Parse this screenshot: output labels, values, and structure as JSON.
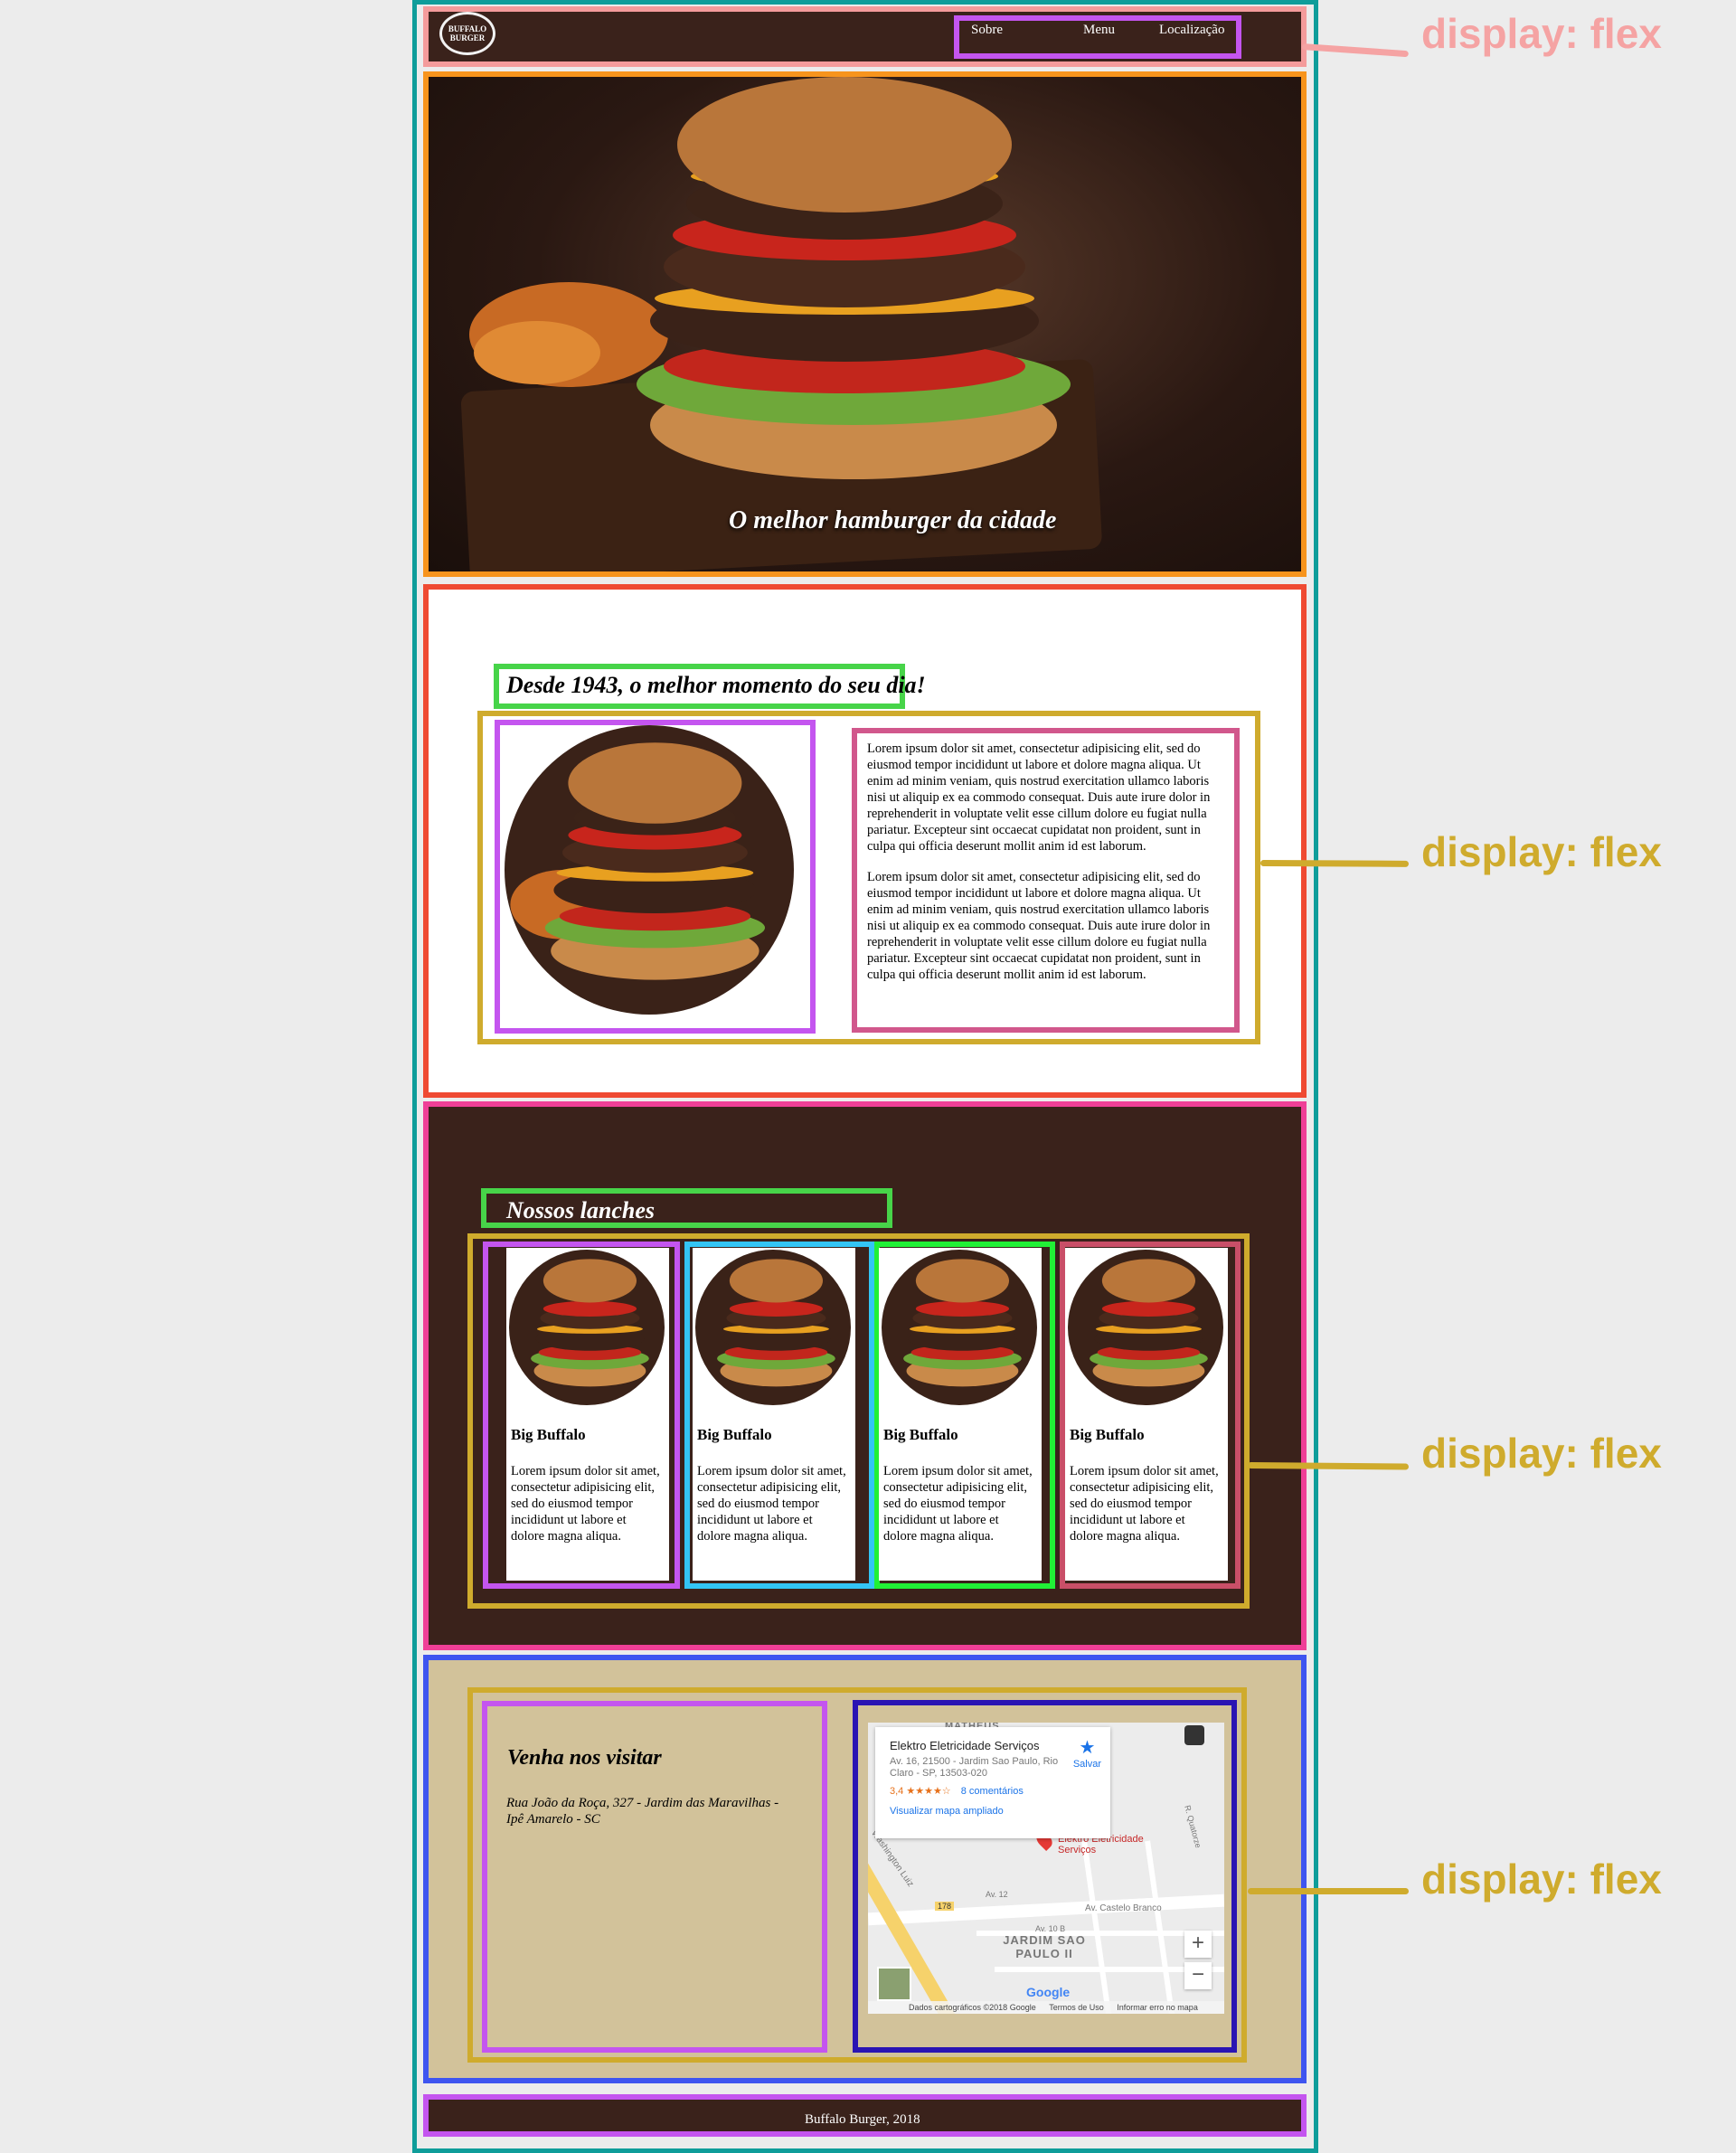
{
  "header": {
    "logo_line1": "BUFFALO",
    "logo_line2": "BURGER",
    "nav": [
      "Sobre",
      "Menu",
      "Localização"
    ]
  },
  "hero": {
    "title": "O melhor hamburger da cidade"
  },
  "about": {
    "heading": "Desde 1943, o melhor momento do seu dia!",
    "paragraphs": [
      "Lorem ipsum dolor sit amet, consectetur adipisicing elit, sed do eiusmod tempor incididunt ut labore et dolore magna aliqua. Ut enim ad minim veniam, quis nostrud exercitation ullamco laboris nisi ut aliquip ex ea commodo consequat. Duis aute irure dolor in reprehenderit in voluptate velit esse cillum dolore eu fugiat nulla pariatur. Excepteur sint occaecat cupidatat non proident, sunt in culpa qui officia deserunt mollit anim id est laborum.",
      "Lorem ipsum dolor sit amet, consectetur adipisicing elit, sed do eiusmod tempor incididunt ut labore et dolore magna aliqua. Ut enim ad minim veniam, quis nostrud exercitation ullamco laboris nisi ut aliquip ex ea commodo consequat. Duis aute irure dolor in reprehenderit in voluptate velit esse cillum dolore eu fugiat nulla pariatur. Excepteur sint occaecat cupidatat non proident, sunt in culpa qui officia deserunt mollit anim id est laborum."
    ]
  },
  "menu": {
    "heading": "Nossos lanches",
    "cards": [
      {
        "title": "Big Buffalo",
        "text": "Lorem ipsum dolor sit amet, consectetur adipisicing elit, sed do eiusmod tempor incididunt ut labore et dolore magna aliqua."
      },
      {
        "title": "Big Buffalo",
        "text": "Lorem ipsum dolor sit amet, consectetur adipisicing elit, sed do eiusmod tempor incididunt ut labore et dolore magna aliqua."
      },
      {
        "title": "Big Buffalo",
        "text": "Lorem ipsum dolor sit amet, consectetur adipisicing elit, sed do eiusmod tempor incididunt ut labore et dolore magna aliqua."
      },
      {
        "title": "Big Buffalo",
        "text": "Lorem ipsum dolor sit amet, consectetur adipisicing elit, sed do eiusmod tempor incididunt ut labore et dolore magna aliqua."
      }
    ]
  },
  "visit": {
    "title": "Venha nos visitar",
    "address": "Rua João da Roça, 327 - Jardim das Maravilhas - Ipê Amarelo - SC"
  },
  "map": {
    "place_name": "Elektro Eletricidade Serviços",
    "place_address": "Av. 16, 21500 - Jardim Sao Paulo, Rio Claro - SP, 13503-020",
    "rating": "3,4",
    "stars": "★★★★☆",
    "reviews": "8 comentários",
    "save": "Salvar",
    "enlarge": "Visualizar mapa ampliado",
    "pin_label": "Elektro Eletricidade Serviços",
    "neighborhood_top": "MATHEUS",
    "neighborhood": "JARDIM SAO PAULO II",
    "street1": "Av. Castelo Branco",
    "street2": "Washington Luiz",
    "street3": "Av. 12",
    "street4": "Av. 10 B",
    "street5": "R. Quatorze",
    "badge": "178",
    "google": "Google",
    "attribution": "Dados cartográficos ©2018 Google",
    "terms": "Termos de Uso",
    "report": "Informar erro no mapa",
    "zoom_in": "+",
    "zoom_out": "−"
  },
  "footer": {
    "text": "Buffalo Burger, 2018"
  },
  "annotations": [
    "display: flex",
    "display: flex",
    "display: flex",
    "display: flex"
  ],
  "colors": {
    "annot_header": "#f5a3a3",
    "annot_section": "#cfab2d",
    "dark_brown": "#3a221b",
    "tan": "#d2c29a",
    "frame": "#0f9d9a"
  }
}
